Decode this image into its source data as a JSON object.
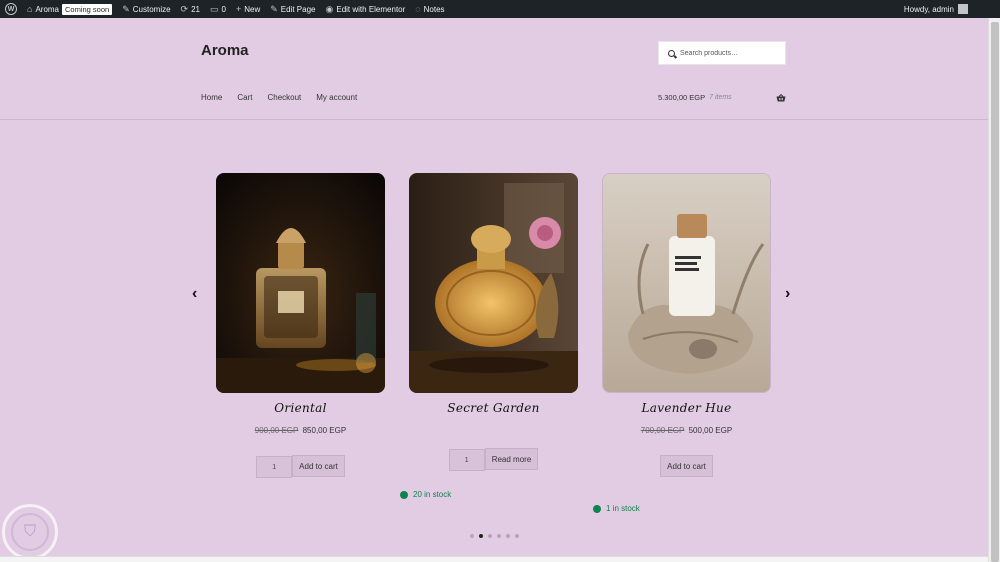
{
  "adminbar": {
    "site_name": "Aroma",
    "coming_soon": "Coming soon",
    "customize": "Customize",
    "updates_count": "21",
    "comments_count": "0",
    "new": "New",
    "edit_page": "Edit Page",
    "edit_elementor": "Edit with Elementor",
    "notes": "Notes",
    "howdy": "Howdy, admin"
  },
  "header": {
    "site_title": "Aroma",
    "search_placeholder": "Search products…"
  },
  "nav": {
    "items": [
      "Home",
      "Cart",
      "Checkout",
      "My account"
    ]
  },
  "cart": {
    "total": "5.300,00 EGP",
    "count": "7 items"
  },
  "products": [
    {
      "title": "Oriental",
      "old_price": "900,00 EGP",
      "price": "850,00 EGP",
      "qty": "1",
      "button": "Add to cart"
    },
    {
      "title": "Secret Garden",
      "qty": "1",
      "button": "Read more",
      "stock": "20 in stock"
    },
    {
      "title": "Lavender Hue",
      "old_price": "700,00 EGP",
      "price": "500,00 EGP",
      "button": "Add to cart",
      "stock": "1 in stock"
    }
  ],
  "carousel": {
    "dot_count": 6,
    "active_dot": 1
  },
  "colors": {
    "background": "#e2cce4",
    "adminbar": "#1d2327",
    "stock_green": "#0f834d"
  }
}
